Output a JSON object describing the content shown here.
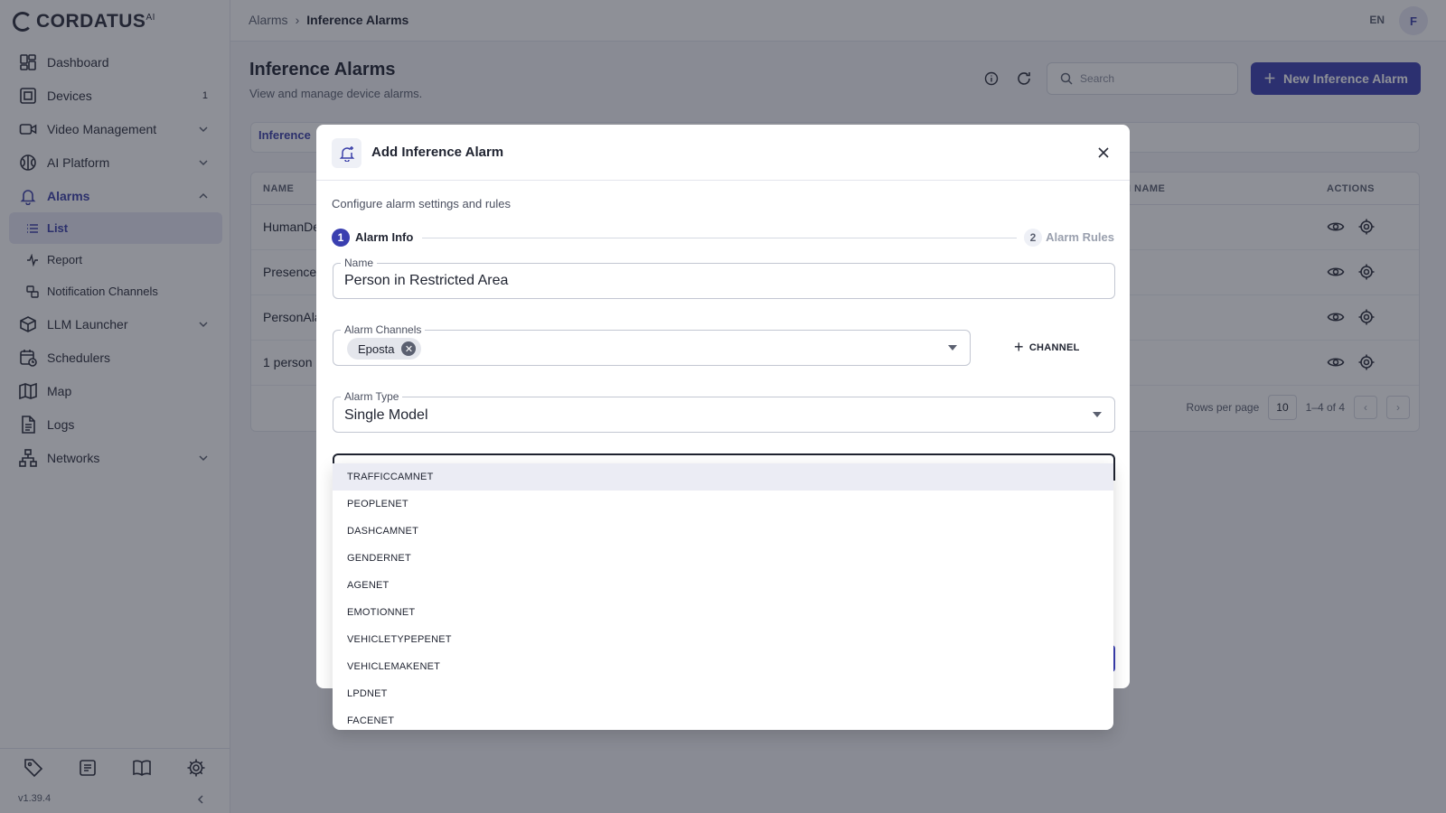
{
  "app": {
    "brand": "CORDATUS",
    "brand_sup": "AI",
    "version": "v1.39.4"
  },
  "sidebar": {
    "items": [
      {
        "label": "Dashboard",
        "icon": "dashboard-icon"
      },
      {
        "label": "Devices",
        "icon": "devices-icon",
        "badge": "1"
      },
      {
        "label": "Video Management",
        "icon": "video-camera-icon"
      },
      {
        "label": "AI Platform",
        "icon": "brain-icon"
      },
      {
        "label": "Alarms",
        "icon": "bell-icon"
      },
      {
        "label": "LLM Launcher",
        "icon": "package-icon"
      },
      {
        "label": "Schedulers",
        "icon": "calendar-clock-icon"
      },
      {
        "label": "Map",
        "icon": "map-icon"
      },
      {
        "label": "Logs",
        "icon": "document-icon"
      },
      {
        "label": "Networks",
        "icon": "network-icon"
      }
    ],
    "alarm_sub": [
      {
        "label": "List",
        "icon": "list-icon"
      },
      {
        "label": "Report",
        "icon": "activity-icon"
      },
      {
        "label": "Notification Channels",
        "icon": "channels-icon"
      }
    ]
  },
  "topbar": {
    "crumb_root": "Alarms",
    "crumb_current": "Inference Alarms",
    "lang": "EN",
    "avatar": "F"
  },
  "page": {
    "title": "Inference Alarms",
    "subtitle": "View and manage device alarms.",
    "search_placeholder": "Search",
    "new_button": "New Inference Alarm",
    "tab": "Inference"
  },
  "table": {
    "col_name": "NAME",
    "col_model_name": "N NAME",
    "col_actions": "ACTIONS",
    "rows": [
      "HumanDe",
      "Presence",
      "PersonAla",
      "1 person"
    ],
    "rows_per_page_label": "Rows per page",
    "rows_per_page": "10",
    "range": "1–4 of 4"
  },
  "modal": {
    "title": "Add Inference Alarm",
    "description": "Configure alarm settings and rules",
    "step1_num": "1",
    "step1_label": "Alarm Info",
    "step2_num": "2",
    "step2_label": "Alarm Rules",
    "name_label": "Name",
    "name_value": "Person in Restricted Area",
    "channels_label": "Alarm Channels",
    "channel_chip": "Eposta",
    "add_channel": "CHANNEL",
    "type_label": "Alarm Type",
    "type_value": "Single Model"
  },
  "dropdown": {
    "options": [
      "TRAFFICCAMNET",
      "PEOPLENET",
      "DASHCAMNET",
      "GENDERNET",
      "AGENET",
      "EMOTIONNET",
      "VEHICLETYPEPENET",
      "VEHICLEMAKENET",
      "LPDNET",
      "FACENET"
    ],
    "highlighted": "TRAFFICCAMNET"
  },
  "colors": {
    "accent": "#3a3fb0",
    "accent_text": "#3a3fa8",
    "overlay": "rgba(30,34,48,0.5)"
  }
}
